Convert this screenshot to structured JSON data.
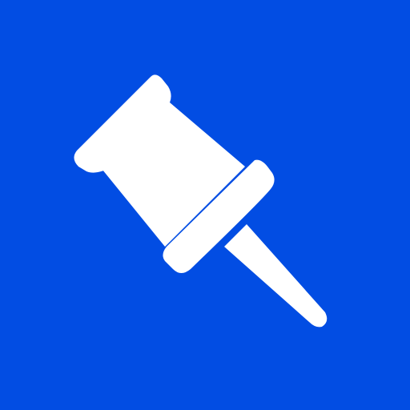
{
  "app_icon": {
    "icon": "pushpin-icon",
    "background_color": "#024DE3",
    "glyph_color": "#FFFFFF"
  }
}
